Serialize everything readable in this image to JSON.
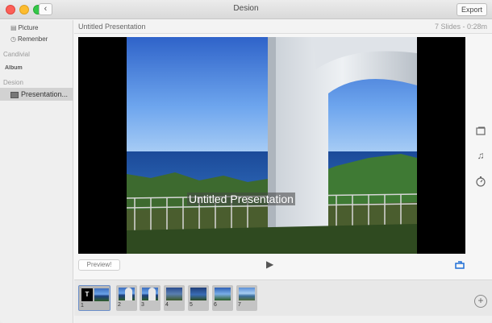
{
  "window": {
    "title": "Desion",
    "export_label": "Export",
    "back_glyph": "‹"
  },
  "sidebar": {
    "items": [
      {
        "label": "Picture",
        "icon": "picture-icon"
      },
      {
        "label": "Remenber",
        "icon": "clock-icon"
      }
    ],
    "section1": "Candivial",
    "album": "Album",
    "section2": "Desion",
    "selected": {
      "label": "Presentation...",
      "icon": "slideshow-icon"
    }
  },
  "header": {
    "doc_title": "Untitled Presentation",
    "slide_info": "7 Slides - 0:28m"
  },
  "stage": {
    "caption": "Untitled Presentation"
  },
  "controls": {
    "preview_label": "Preview!",
    "play_icon": "play-icon",
    "loop_icon": "loop-icon"
  },
  "tools": {
    "layout_icon": "layout-icon",
    "music_icon": "music-note-icon",
    "timer_icon": "timer-icon",
    "add_icon": "plus-circle-icon"
  },
  "filmstrip": {
    "thumbs": [
      {
        "num": "1",
        "title_glyph": "T"
      },
      {
        "num": "2"
      },
      {
        "num": "3"
      },
      {
        "num": "4"
      },
      {
        "num": "5"
      },
      {
        "num": "6"
      },
      {
        "num": "7"
      }
    ]
  },
  "colors": {
    "accent": "#1f6fd6",
    "sidebar_selected": "#d2d2d2"
  }
}
